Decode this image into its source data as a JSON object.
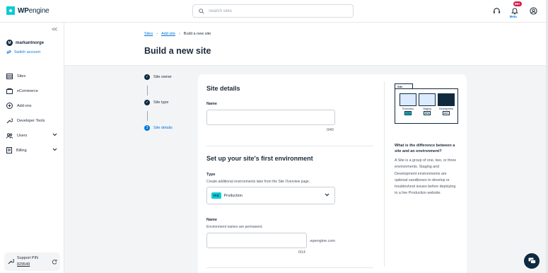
{
  "brand": {
    "logo_wp": "WP",
    "logo_engine": "engine"
  },
  "search": {
    "placeholder": "Search sites"
  },
  "topbar": {
    "badge": "99+",
    "beta": "Beta"
  },
  "sidebar": {
    "account_initial": "M",
    "account_name": "markantnorge",
    "switch_account": "Switch account",
    "items": [
      {
        "label": "Sites",
        "icon": "sites-icon"
      },
      {
        "label": "eCommerce",
        "icon": "cart-icon"
      },
      {
        "label": "Add-ons",
        "icon": "plus-circle-icon"
      },
      {
        "label": "Developer Tools",
        "icon": "wrench-icon"
      },
      {
        "label": "Users",
        "icon": "users-icon"
      },
      {
        "label": "Billing",
        "icon": "billing-icon"
      }
    ],
    "support_label": "Support PIN",
    "support_pin": "829549"
  },
  "breadcrumb": {
    "sites": "Sites",
    "add_site": "Add site",
    "current": "Build a new site"
  },
  "page_title": "Build a new site",
  "steps": [
    {
      "label": "Site owner",
      "state": "done"
    },
    {
      "label": "Site type",
      "state": "done"
    },
    {
      "label": "Site details",
      "state": "active",
      "number": "3"
    }
  ],
  "site_details": {
    "title": "Site details",
    "name_label": "Name",
    "name_value": "",
    "name_counter": "0/40"
  },
  "environment": {
    "title": "Set up your site's first environment",
    "type_label": "Type",
    "type_help": "Create additional environments later from the Site Overview page.",
    "type_pill": "Prd",
    "type_value": "Production",
    "name_label": "Name",
    "name_help": "Environment names are permanent.",
    "name_value": "",
    "name_suffix": ".wpengine.com",
    "name_counter": "0/14"
  },
  "info": {
    "illus_tab": "Site",
    "envs": [
      {
        "label": "Production",
        "tag": "PRD"
      },
      {
        "label": "Staging",
        "tag": "STG"
      },
      {
        "label": "Development",
        "tag": "DEV"
      }
    ],
    "question": "What is the difference between a site and an environment?",
    "answer": "A Site is a group of one, two, or three environments. Staging and Development environments are optional sandboxes to develop or troubleshoot issues before deploying to a live Production website."
  },
  "colors": {
    "accent": "#0076dc",
    "brand": "#0ecad4",
    "dark": "#0f2a3f",
    "bg": "#f3f4f6"
  }
}
